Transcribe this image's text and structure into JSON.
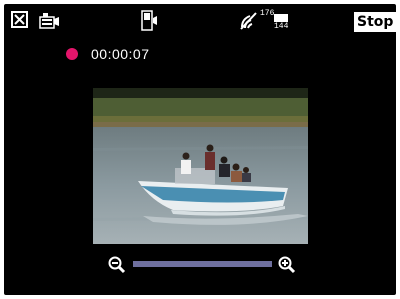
{
  "topbar": {
    "close_icon": "close-box-icon",
    "camera_icon": "camera-icon",
    "device_icon": "device-icon",
    "no_signal_icon": "no-signal-icon",
    "resolution_top": "176",
    "resolution_bottom": "144",
    "stop_label": "Stop"
  },
  "recording": {
    "dot_color": "#e4156b",
    "elapsed": "00:00:07"
  },
  "preview": {
    "subject": "speedboat-on-water"
  },
  "zoom": {
    "zoom_out_icon": "zoom-out-icon",
    "zoom_in_icon": "zoom-in-icon",
    "level": 1.0,
    "track_color": "#6e6f9e"
  }
}
